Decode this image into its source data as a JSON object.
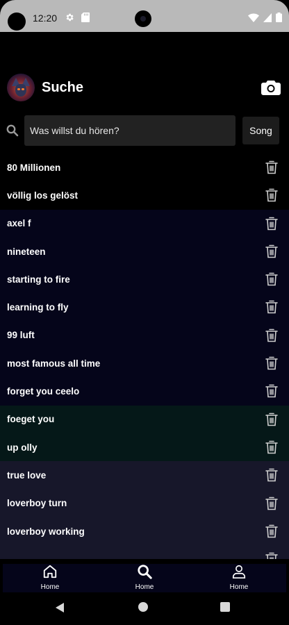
{
  "status_bar": {
    "time": "12:20",
    "icons": [
      "gear-icon",
      "sd-card-icon",
      "wifi-icon",
      "signal-icon",
      "battery-icon"
    ]
  },
  "header": {
    "title": "Suche",
    "avatar_icon": "wolf-avatar",
    "camera_icon": "camera-icon"
  },
  "search": {
    "placeholder": "Was willst du hören?",
    "value": "",
    "button_label": "Song"
  },
  "history": {
    "items": [
      {
        "label": "80 Millionen",
        "bg": "black"
      },
      {
        "label": "völlig los gelöst",
        "bg": "black"
      },
      {
        "label": "axel f",
        "bg": "navy"
      },
      {
        "label": "nineteen",
        "bg": "navy"
      },
      {
        "label": "starting to fire",
        "bg": "navy"
      },
      {
        "label": "learning to fly",
        "bg": "navy"
      },
      {
        "label": "99 luft",
        "bg": "navy"
      },
      {
        "label": "most famous all time",
        "bg": "navy"
      },
      {
        "label": "forget you ceelo",
        "bg": "navy"
      },
      {
        "label": "foeget you",
        "bg": "teal"
      },
      {
        "label": "up olly",
        "bg": "teal"
      },
      {
        "label": "true love",
        "bg": "gray"
      },
      {
        "label": "loverboy turn",
        "bg": "gray"
      },
      {
        "label": "loverboy working",
        "bg": "gray"
      },
      {
        "label": "",
        "bg": "gray"
      }
    ]
  },
  "bottom_nav": {
    "items": [
      {
        "label": "Home",
        "icon": "home-icon"
      },
      {
        "label": "Home",
        "icon": "search-icon"
      },
      {
        "label": "Home",
        "icon": "person-icon"
      }
    ]
  },
  "colors": {
    "background": "#000000",
    "status_bar": "#b9b9b9",
    "input_bg": "#222222",
    "row_navy": "#05051a",
    "row_teal": "#051818",
    "row_gray": "#17172a"
  }
}
